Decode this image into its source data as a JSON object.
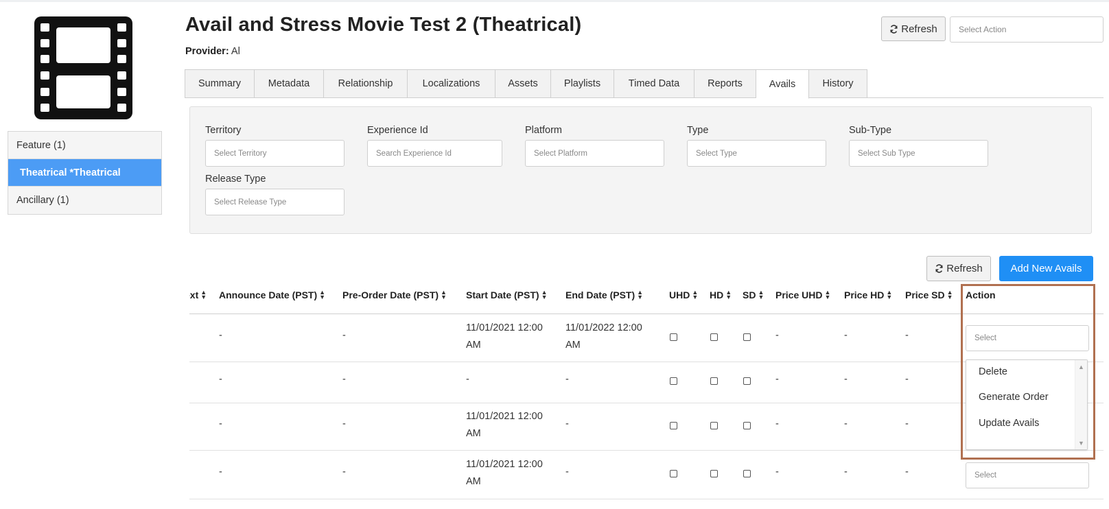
{
  "header": {
    "title": "Avail and Stress Movie Test 2 (Theatrical)",
    "provider_label": "Provider:",
    "provider_value": "Al",
    "refresh_label": "Refresh",
    "action_placeholder": "Select Action"
  },
  "sidebar": {
    "items": [
      {
        "label": "Feature (1)"
      },
      {
        "label": "Theatrical *Theatrical"
      },
      {
        "label": "Ancillary (1)"
      }
    ]
  },
  "tabs": [
    {
      "label": "Summary"
    },
    {
      "label": "Metadata"
    },
    {
      "label": "Relationship"
    },
    {
      "label": "Localizations"
    },
    {
      "label": "Assets"
    },
    {
      "label": "Playlists"
    },
    {
      "label": "Timed Data"
    },
    {
      "label": "Reports"
    },
    {
      "label": "Avails"
    },
    {
      "label": "History"
    }
  ],
  "filters": {
    "territory": {
      "label": "Territory",
      "placeholder": "Select Territory"
    },
    "experience": {
      "label": "Experience Id",
      "placeholder": "Search Experience Id"
    },
    "platform": {
      "label": "Platform",
      "placeholder": "Select Platform"
    },
    "type": {
      "label": "Type",
      "placeholder": "Select Type"
    },
    "subtype": {
      "label": "Sub-Type",
      "placeholder": "Select Sub Type"
    },
    "release": {
      "label": "Release Type",
      "placeholder": "Select Release Type"
    }
  },
  "toolbar": {
    "refresh_label": "Refresh",
    "add_label": "Add New Avails"
  },
  "table": {
    "columns": [
      "ext",
      "Announce Date (PST)",
      "Pre-Order Date (PST)",
      "Start Date (PST)",
      "End Date (PST)",
      "UHD",
      "HD",
      "SD",
      "Price UHD",
      "Price HD",
      "Price SD",
      "Action"
    ],
    "rows": [
      {
        "announce": "-",
        "preorder": "-",
        "start_line1": "11/01/2021 12:00",
        "start_line2": "AM",
        "end_line1": "11/01/2022 12:00",
        "end_line2": "AM",
        "price_uhd": "-",
        "price_hd": "-",
        "price_sd": "-",
        "action_placeholder": "Select"
      },
      {
        "announce": "-",
        "preorder": "-",
        "start_line1": "-",
        "start_line2": "",
        "end_line1": "-",
        "end_line2": "",
        "price_uhd": "-",
        "price_hd": "-",
        "price_sd": "-"
      },
      {
        "announce": "-",
        "preorder": "-",
        "start_line1": "11/01/2021 12:00",
        "start_line2": "AM",
        "end_line1": "-",
        "end_line2": "",
        "price_uhd": "-",
        "price_hd": "-",
        "price_sd": "-"
      },
      {
        "announce": "-",
        "preorder": "-",
        "start_line1": "11/01/2021 12:00",
        "start_line2": "AM",
        "end_line1": "-",
        "end_line2": "",
        "price_uhd": "-",
        "price_hd": "-",
        "price_sd": "-",
        "action_placeholder": "Select"
      }
    ]
  },
  "dropdown": {
    "options": [
      "Delete",
      "Generate Order",
      "Update Avails"
    ]
  },
  "icons": {
    "film": "film-strip-icon",
    "refresh": "refresh-icon",
    "sort": "sort-icon"
  },
  "colors": {
    "accent": "#1f8ff5",
    "active_nav": "#4c9cf5",
    "highlight": "#b07050"
  }
}
